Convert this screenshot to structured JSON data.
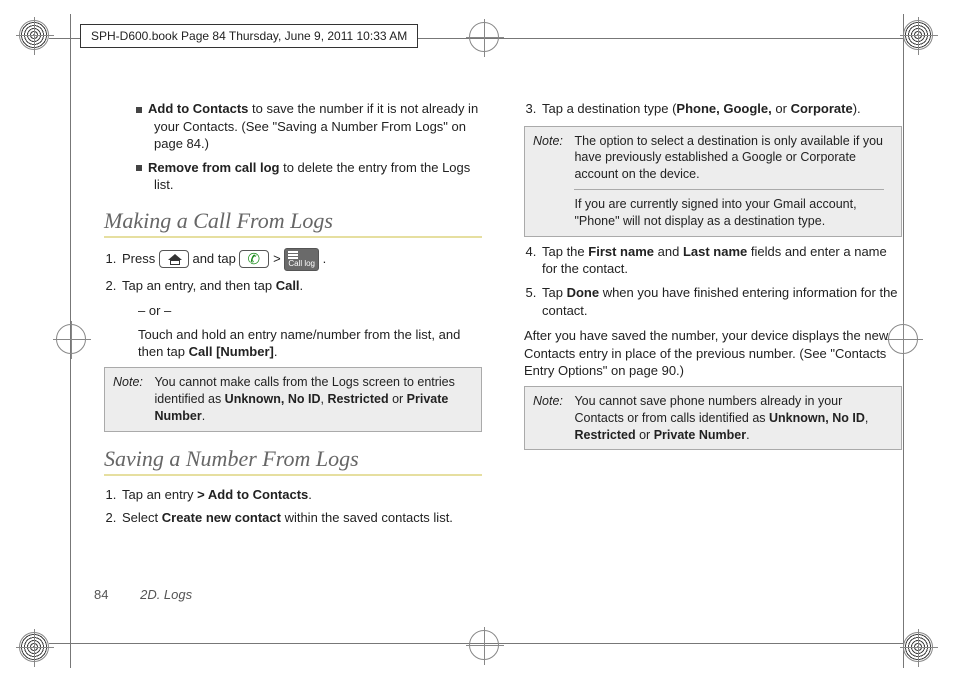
{
  "header": {
    "meta": "SPH-D600.book  Page 84  Thursday, June 9, 2011  10:33 AM"
  },
  "left": {
    "bullets": {
      "addContacts": {
        "bold": "Add to Contacts",
        "text": " to save the number if it is not already in your Contacts. (See \"Saving a Number From Logs\" on page 84.)"
      },
      "removeLog": {
        "bold": "Remove from call log",
        "text": " to delete the entry from the Logs list."
      }
    },
    "section1": {
      "title": "Making a Call From Logs"
    },
    "steps1": {
      "s1a": "Press ",
      "s1b": " and tap ",
      "gt": " > ",
      "s1c": ".",
      "s2a": "Tap an entry, and then tap ",
      "s2b": "Call",
      "s2c": ".",
      "or": "– or –",
      "s2d": "Touch and hold an entry name/number from the list, and then tap ",
      "s2e": "Call [Number]",
      "s2f": "."
    },
    "note1": {
      "label": "Note:",
      "text1": "You cannot make calls from the Logs screen to entries identified as ",
      "b1": "Unknown, No ID",
      "sep1": ", ",
      "b2": "Restricted",
      "sep2": " or ",
      "b3": "Private Number",
      "end": "."
    },
    "section2": {
      "title": "Saving a Number From Logs"
    },
    "steps2": {
      "s1a": "Tap an entry ",
      "s1gt": ">",
      "s1b": " Add to Contacts",
      "s1c": ".",
      "s2a": "Select ",
      "s2b": "Create new contact",
      "s2c": " within the saved contacts list."
    }
  },
  "right": {
    "steps3": {
      "s3a": "Tap a destination type (",
      "s3b": "Phone, Google,",
      "s3c": " or ",
      "s3d": "Corporate",
      "s3e": ")."
    },
    "note2": {
      "label": "Note:",
      "p1": "The option to select a destination is only available if you have previously established a Google or Corporate account on the device.",
      "p2": "If you are currently signed into your Gmail account, \"Phone\" will not display as a destination type."
    },
    "steps4": {
      "s4a": "Tap the ",
      "s4b": "First name",
      "s4c": " and ",
      "s4d": "Last name",
      "s4e": " fields and enter a name for the contact.",
      "s5a": "Tap ",
      "s5b": "Done",
      "s5c": " when you have finished entering information for the contact."
    },
    "para": "After you have saved the number, your device displays the new Contacts entry in place of the previous number. (See \"Contacts Entry Options\" on page 90.)",
    "note3": {
      "label": "Note:",
      "t1": "You cannot save phone numbers already in your Contacts or from calls identified as ",
      "b1": "Unknown, No ID",
      "sep1": ", ",
      "b2": "Restricted",
      "sep2": " or ",
      "b3": "Private Number",
      "end": "."
    }
  },
  "calllog_label": "Call log",
  "footer": {
    "page": "84",
    "section": "2D. Logs"
  }
}
